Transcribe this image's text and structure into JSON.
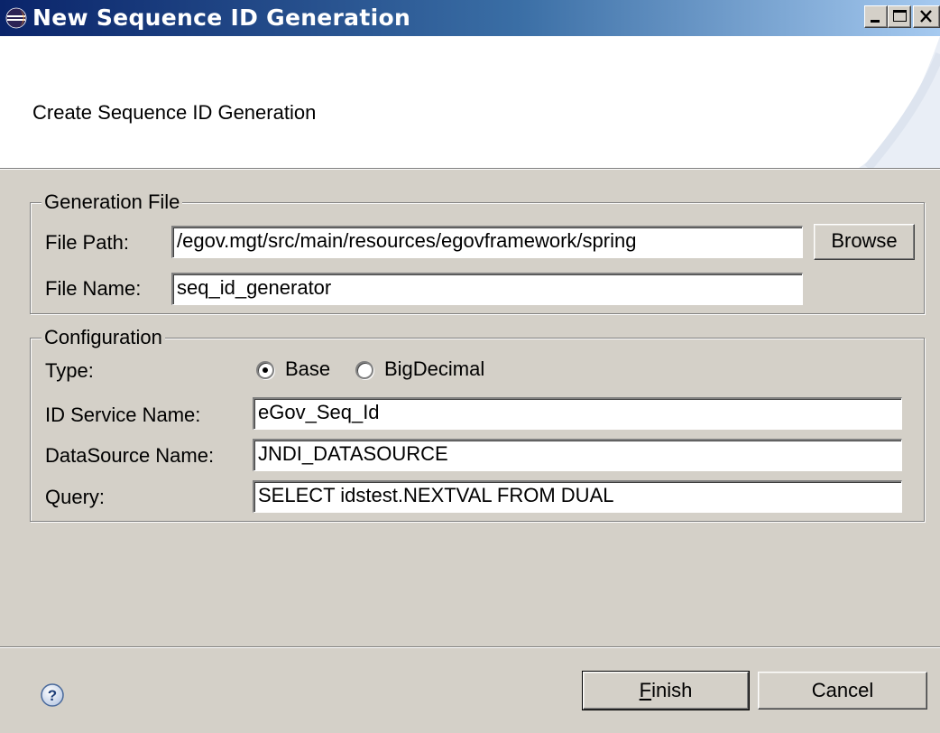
{
  "window": {
    "title": "New Sequence ID Generation",
    "icons": {
      "app": "eclipse-icon",
      "minimize": "minimize-icon",
      "maximize": "maximize-icon",
      "close": "close-icon"
    }
  },
  "banner": {
    "title": "Create Sequence ID Generation"
  },
  "generation_file": {
    "legend": "Generation File",
    "file_path_label": "File Path:",
    "file_path_value": "/egov.mgt/src/main/resources/egovframework/spring",
    "browse_label": "Browse",
    "file_name_label": "File Name:",
    "file_name_value": "seq_id_generator"
  },
  "configuration": {
    "legend": "Configuration",
    "type_label": "Type:",
    "type_options": [
      {
        "label": "Base",
        "selected": true
      },
      {
        "label": "BigDecimal",
        "selected": false
      }
    ],
    "id_service_label": "ID Service Name:",
    "id_service_value": "eGov_Seq_Id",
    "datasource_label": "DataSource Name:",
    "datasource_value": "JNDI_DATASOURCE",
    "query_label": "Query:",
    "query_value": "SELECT idstest.NEXTVAL FROM DUAL"
  },
  "footer": {
    "help_icon": "help-icon",
    "finish_mnemonic": "F",
    "finish_rest": "inish",
    "cancel_label": "Cancel"
  },
  "colors": {
    "dialog_bg": "#d4d0c8",
    "title_gradient_start": "#0a246a",
    "title_gradient_end": "#a6caf0"
  }
}
